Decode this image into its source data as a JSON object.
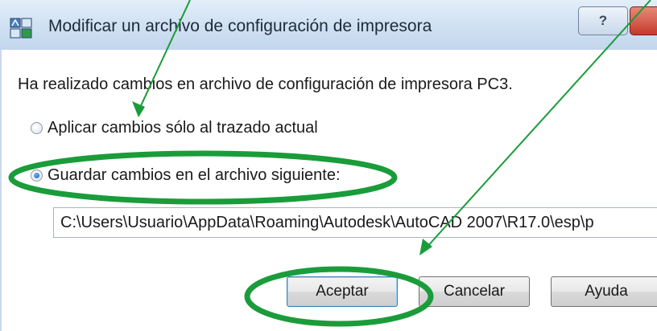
{
  "window": {
    "title": "Modificar un archivo de configuración de impresora",
    "help_glyph": "?"
  },
  "dialog": {
    "message": "Ha realizado cambios en archivo de configuración de impresora PC3.",
    "options": [
      {
        "label": "Aplicar cambios sólo al trazado actual",
        "selected": false
      },
      {
        "label": "Guardar cambios en el archivo siguiente:",
        "selected": true
      }
    ],
    "file_path": "C:\\Users\\Usuario\\AppData\\Roaming\\Autodesk\\AutoCAD 2007\\R17.0\\esp\\p"
  },
  "buttons": {
    "accept": "Aceptar",
    "cancel": "Cancelar",
    "help": "Ayuda"
  },
  "colors": {
    "annotation": "#1a9c3a",
    "titlebar": "#cfe0f2"
  }
}
